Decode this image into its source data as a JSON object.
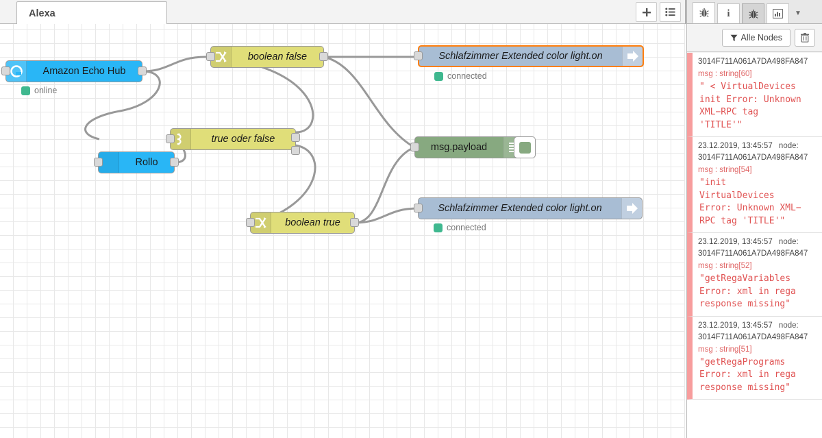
{
  "header": {
    "tab_label": "Alexa",
    "buttons": [
      {
        "name": "add-flow-button",
        "icon": "plus-icon",
        "label": "+"
      },
      {
        "name": "flow-list-button",
        "icon": "list-icon",
        "label": "☰"
      }
    ]
  },
  "sidebar": {
    "tabs": [
      {
        "name": "tab-debug",
        "icon": "bug-icon",
        "label": "🐞",
        "state": "active"
      },
      {
        "name": "tab-info",
        "icon": "info-icon",
        "label": "i",
        "state": "normal"
      },
      {
        "name": "tab-debug-messages",
        "icon": "bug-icon",
        "label": "🐞",
        "state": "pressed"
      },
      {
        "name": "tab-dashboard",
        "icon": "chart-bars-icon",
        "label": "📊",
        "state": "normal"
      }
    ],
    "caret": "▼",
    "toolbar": {
      "filter_label": "Alle Nodes",
      "filter_icon": "funnel-icon",
      "clear_icon": "trash-icon"
    },
    "messages": [
      {
        "timestamp": "",
        "node_label": "",
        "node_id": "3014F711A061A7DA498FA847",
        "type": "msg : string[60]",
        "payload": "\" < VirtualDevices\ninit Error: Unknown\nXML−RPC tag\n'TITLE'\""
      },
      {
        "timestamp": "23.12.2019, 13:45:57",
        "node_label": "node:",
        "node_id": "3014F711A061A7DA498FA847",
        "type": "msg : string[54]",
        "payload": "\"init\nVirtualDevices\nError: Unknown XML−\nRPC tag 'TITLE'\""
      },
      {
        "timestamp": "23.12.2019, 13:45:57",
        "node_label": "node:",
        "node_id": "3014F711A061A7DA498FA847",
        "type": "msg : string[52]",
        "payload": "\"getRegaVariables\nError: xml in rega\nresponse missing\""
      },
      {
        "timestamp": "23.12.2019, 13:45:57",
        "node_label": "node:",
        "node_id": "3014F711A061A7DA498FA847",
        "type": "msg : string[51]",
        "payload": "\"getRegaPrograms\nError: xml in rega\nresponse missing\""
      }
    ]
  },
  "flow": {
    "nodes": [
      {
        "id": "echo-hub",
        "label": "Amazon Echo Hub",
        "status": "online"
      },
      {
        "id": "rollo",
        "label": "Rollo",
        "status": ""
      },
      {
        "id": "bool-false",
        "label": "boolean false",
        "status": ""
      },
      {
        "id": "true-oder-false",
        "label": "true oder false",
        "status": ""
      },
      {
        "id": "bool-true",
        "label": "boolean true",
        "status": ""
      },
      {
        "id": "light-on-1",
        "label": "Schlafzimmer Extended color light.on",
        "status": "connected"
      },
      {
        "id": "light-on-2",
        "label": "Schlafzimmer Extended color light.on",
        "status": "connected"
      },
      {
        "id": "debug-payload",
        "label": "msg.payload",
        "status": ""
      }
    ]
  },
  "colors": {
    "alexa_node": "#29b6f6",
    "switch_node": "#e0de79",
    "debug_node": "#87a980",
    "output_node": "#a8bdd4",
    "selection": "#ff7f0e",
    "status_ok": "#3fb88f",
    "error_text": "#e05252",
    "error_bar": "#f79d9d"
  }
}
